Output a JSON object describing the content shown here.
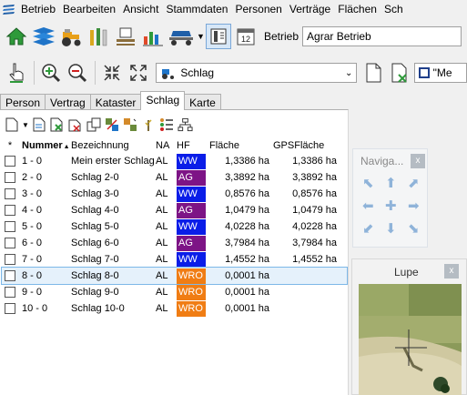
{
  "menu": {
    "items": [
      {
        "label": "Betrieb",
        "icon": "app-logo-icon"
      },
      {
        "label": "Bearbeiten"
      },
      {
        "label": "Ansicht"
      },
      {
        "label": "Stammdaten"
      },
      {
        "label": "Personen"
      },
      {
        "label": "Verträge"
      },
      {
        "label": "Flächen"
      },
      {
        "label": "Sch"
      }
    ]
  },
  "toolbar": {
    "betrieb_label": "Betrieb",
    "betrieb_value": "Agrar Betrieb",
    "calendar_number": "12"
  },
  "toolbar2": {
    "select_value": "Schlag",
    "small_input_value": "\"Me"
  },
  "tabs": [
    {
      "label": "Person"
    },
    {
      "label": "Vertrag"
    },
    {
      "label": "Kataster"
    },
    {
      "label": "Schlag",
      "active": true
    },
    {
      "label": "Karte"
    }
  ],
  "table": {
    "headers": {
      "star": "*",
      "nummer": "Nummer",
      "bezeichnung": "Bezeichnung",
      "na": "NA",
      "hf": "HF",
      "flaeche": "Fläche",
      "gps": "GPSFläche"
    },
    "rows": [
      {
        "nummer": "1 - 0",
        "bezeichnung": "Mein erster Schlag",
        "na": "AL",
        "hf": "WW",
        "hf_color": "#0a1de8",
        "flaeche": "1,3386 ha",
        "gps": "1,3386 ha"
      },
      {
        "nummer": "2 - 0",
        "bezeichnung": "Schlag 2-0",
        "na": "AL",
        "hf": "AG",
        "hf_color": "#7d1486",
        "flaeche": "3,3892 ha",
        "gps": "3,3892 ha"
      },
      {
        "nummer": "3 - 0",
        "bezeichnung": "Schlag 3-0",
        "na": "AL",
        "hf": "WW",
        "hf_color": "#0a1de8",
        "flaeche": "0,8576 ha",
        "gps": "0,8576 ha"
      },
      {
        "nummer": "4 - 0",
        "bezeichnung": "Schlag 4-0",
        "na": "AL",
        "hf": "AG",
        "hf_color": "#7d1486",
        "flaeche": "1,0479 ha",
        "gps": "1,0479 ha"
      },
      {
        "nummer": "5 - 0",
        "bezeichnung": "Schlag 5-0",
        "na": "AL",
        "hf": "WW",
        "hf_color": "#0a1de8",
        "flaeche": "4,0228 ha",
        "gps": "4,0228 ha"
      },
      {
        "nummer": "6 - 0",
        "bezeichnung": "Schlag 6-0",
        "na": "AL",
        "hf": "AG",
        "hf_color": "#7d1486",
        "flaeche": "3,7984 ha",
        "gps": "3,7984 ha"
      },
      {
        "nummer": "7 - 0",
        "bezeichnung": "Schlag 7-0",
        "na": "AL",
        "hf": "WW",
        "hf_color": "#0a1de8",
        "flaeche": "1,4552 ha",
        "gps": "1,4552 ha"
      },
      {
        "nummer": "8 - 0",
        "bezeichnung": "Schlag 8-0",
        "na": "AL",
        "hf": "WRO",
        "hf_color": "#f07d14",
        "flaeche": "0,0001 ha",
        "gps": "",
        "selected": true
      },
      {
        "nummer": "9 - 0",
        "bezeichnung": "Schlag 9-0",
        "na": "AL",
        "hf": "WRO",
        "hf_color": "#f07d14",
        "flaeche": "0,0001 ha",
        "gps": ""
      },
      {
        "nummer": "10 - 0",
        "bezeichnung": "Schlag 10-0",
        "na": "AL",
        "hf": "WRO",
        "hf_color": "#f07d14",
        "flaeche": "0,0001 ha",
        "gps": ""
      }
    ]
  },
  "navigation": {
    "title": "Naviga...",
    "close": "x"
  },
  "lupe": {
    "title": "Lupe",
    "close": "x"
  }
}
